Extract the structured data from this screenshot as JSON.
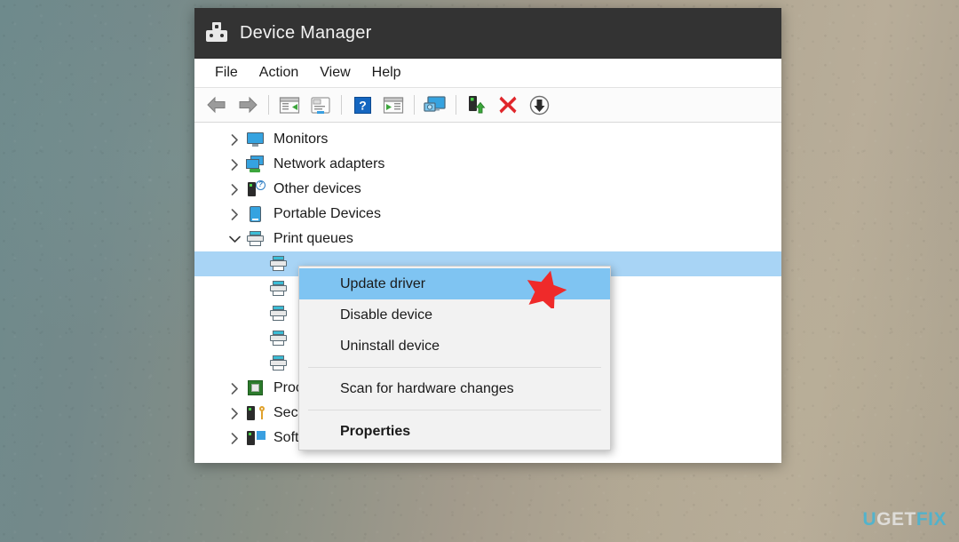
{
  "window": {
    "title": "Device Manager",
    "app_icon": "device-manager-icon"
  },
  "menubar": {
    "items": [
      {
        "label": "File"
      },
      {
        "label": "Action"
      },
      {
        "label": "View"
      },
      {
        "label": "Help"
      }
    ]
  },
  "toolbar": {
    "buttons": [
      {
        "name": "back-button",
        "icon": "back-arrow-icon"
      },
      {
        "name": "forward-button",
        "icon": "forward-arrow-icon"
      },
      {
        "name": "show-hide-console-tree-button",
        "icon": "console-tree-icon"
      },
      {
        "name": "properties-button",
        "icon": "properties-window-icon"
      },
      {
        "name": "help-button",
        "icon": "question-mark-icon"
      },
      {
        "name": "show-hide-action-pane-button",
        "icon": "action-pane-icon"
      },
      {
        "name": "scan-hardware-changes-button",
        "icon": "computer-scan-icon"
      },
      {
        "name": "update-driver-button",
        "icon": "update-driver-icon"
      },
      {
        "name": "uninstall-device-button",
        "icon": "red-x-icon"
      },
      {
        "name": "disable-device-button",
        "icon": "down-arrow-circle-icon"
      }
    ]
  },
  "tree": {
    "nodes": [
      {
        "label": "Monitors",
        "icon": "monitor-icon",
        "expanded": false
      },
      {
        "label": "Network adapters",
        "icon": "network-adapter-icon",
        "expanded": false
      },
      {
        "label": "Other devices",
        "icon": "other-device-icon",
        "expanded": false
      },
      {
        "label": "Portable Devices",
        "icon": "portable-device-icon",
        "expanded": false
      },
      {
        "label": "Print queues",
        "icon": "printer-icon",
        "expanded": true
      },
      {
        "label": "Processors",
        "icon": "processor-icon",
        "expanded": false
      },
      {
        "label": "Security devices",
        "icon": "security-device-icon",
        "expanded": false
      },
      {
        "label": "Software components",
        "icon": "software-component-icon",
        "expanded": false
      }
    ],
    "print_queue_children": [
      {
        "label": "",
        "icon": "printer-icon",
        "selected": true
      },
      {
        "label": "",
        "icon": "printer-icon",
        "selected": false
      },
      {
        "label": "",
        "icon": "printer-icon",
        "selected": false
      },
      {
        "label": "",
        "icon": "printer-icon",
        "selected": false
      },
      {
        "label": "",
        "icon": "printer-icon",
        "selected": false
      }
    ]
  },
  "context_menu": {
    "items": [
      {
        "label": "Update driver",
        "highlighted": true,
        "bold": false
      },
      {
        "label": "Disable device",
        "highlighted": false,
        "bold": false
      },
      {
        "label": "Uninstall device",
        "highlighted": false,
        "bold": false
      },
      {
        "label": "Scan for hardware changes",
        "highlighted": false,
        "bold": false
      },
      {
        "label": "Properties",
        "highlighted": false,
        "bold": true
      }
    ]
  },
  "annotation": {
    "star": {
      "shape": "red-star",
      "color": "#ef2a2a"
    }
  },
  "watermark": {
    "part1": "U",
    "part2": "GET",
    "part3": "FIX",
    "color_blue": "#3fb6d8",
    "color_white": "#e9e9e9"
  },
  "colors": {
    "titlebar": "#333333",
    "selection": "#a8d4f5",
    "menu_highlight": "#7fc4f2",
    "window_bg": "#ffffff"
  }
}
